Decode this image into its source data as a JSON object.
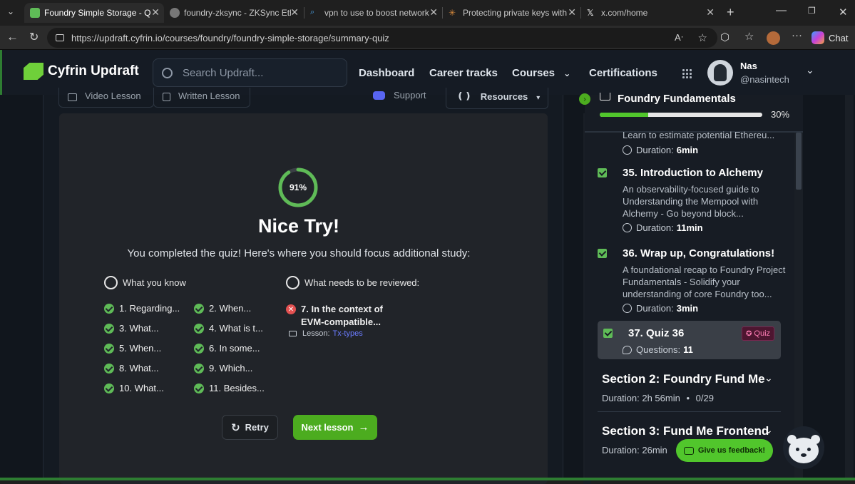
{
  "browser": {
    "tabs": [
      {
        "title": "Foundry Simple Storage - Quiz",
        "active": true
      },
      {
        "title": "foundry-zksync - ZKSync Ethere",
        "active": false
      },
      {
        "title": "vpn to use to boost network sp",
        "active": false
      },
      {
        "title": "Protecting private keys with cas",
        "active": false
      },
      {
        "title": "x.com/home",
        "active": false
      }
    ],
    "url": "https://updraft.cyfrin.io/courses/foundry/foundry-simple-storage/summary-quiz",
    "chat_label": "Chat"
  },
  "header": {
    "logo": "Cyfrin Updraft",
    "search_placeholder": "Search Updraft...",
    "nav": [
      "Dashboard",
      "Career tracks",
      "Courses",
      "Certifications"
    ],
    "user_name": "Nas",
    "user_handle": "@nasintech"
  },
  "lesson_tabs": {
    "video": "Video Lesson",
    "written": "Written Lesson",
    "support": "Support",
    "resources": "Resources"
  },
  "quiz": {
    "score": "91%",
    "score_value": 0.91,
    "headline": "Nice Try!",
    "subline": "You completed the quiz! Here's where you should focus additional study:",
    "known_heading": "What you know",
    "review_heading": "What needs to be reviewed:",
    "known_items": [
      "1. Regarding...",
      "2. When...",
      "3. What...",
      "4. What is t...",
      "5. When...",
      "6. In some...",
      "8. What...",
      "9. Which...",
      "10. What...",
      "11. Besides..."
    ],
    "review_item": "7. In the context of EVM-compatible...",
    "review_lesson_label": "Lesson:",
    "review_lesson_link": "Tx-types",
    "retry_label": "Retry",
    "next_label": "Next lesson"
  },
  "sidebar": {
    "course_title": "Foundry Fundamentals",
    "progress": "30%",
    "progress_value": 0.3,
    "cut_desc": "Learn to estimate potential Ethereu...",
    "cut_duration_label": "Duration:",
    "cut_duration": "6min",
    "lessons": [
      {
        "title": "35. Introduction to Alchemy",
        "desc": "An observability-focused guide to Understanding the Mempool with Alchemy - Go beyond block...",
        "duration_label": "Duration:",
        "duration": "11min"
      },
      {
        "title": "36. Wrap up, Congratulations!",
        "desc": "A foundational recap to Foundry Project Fundamentals - Solidify your understanding of core Foundry too...",
        "duration_label": "Duration:",
        "duration": "3min"
      }
    ],
    "quiz_item": {
      "title": "37. Quiz 36",
      "badge": "Quiz",
      "questions_label": "Questions:",
      "questions": "11"
    },
    "sections": [
      {
        "title": "Section 2: Foundry Fund Me",
        "duration": "Duration: 2h 56min",
        "count": "0/29"
      },
      {
        "title": "Section 3: Fund Me Frontend",
        "duration": "Duration: 26min"
      }
    ],
    "feedback_label": "Give us feedback!"
  }
}
